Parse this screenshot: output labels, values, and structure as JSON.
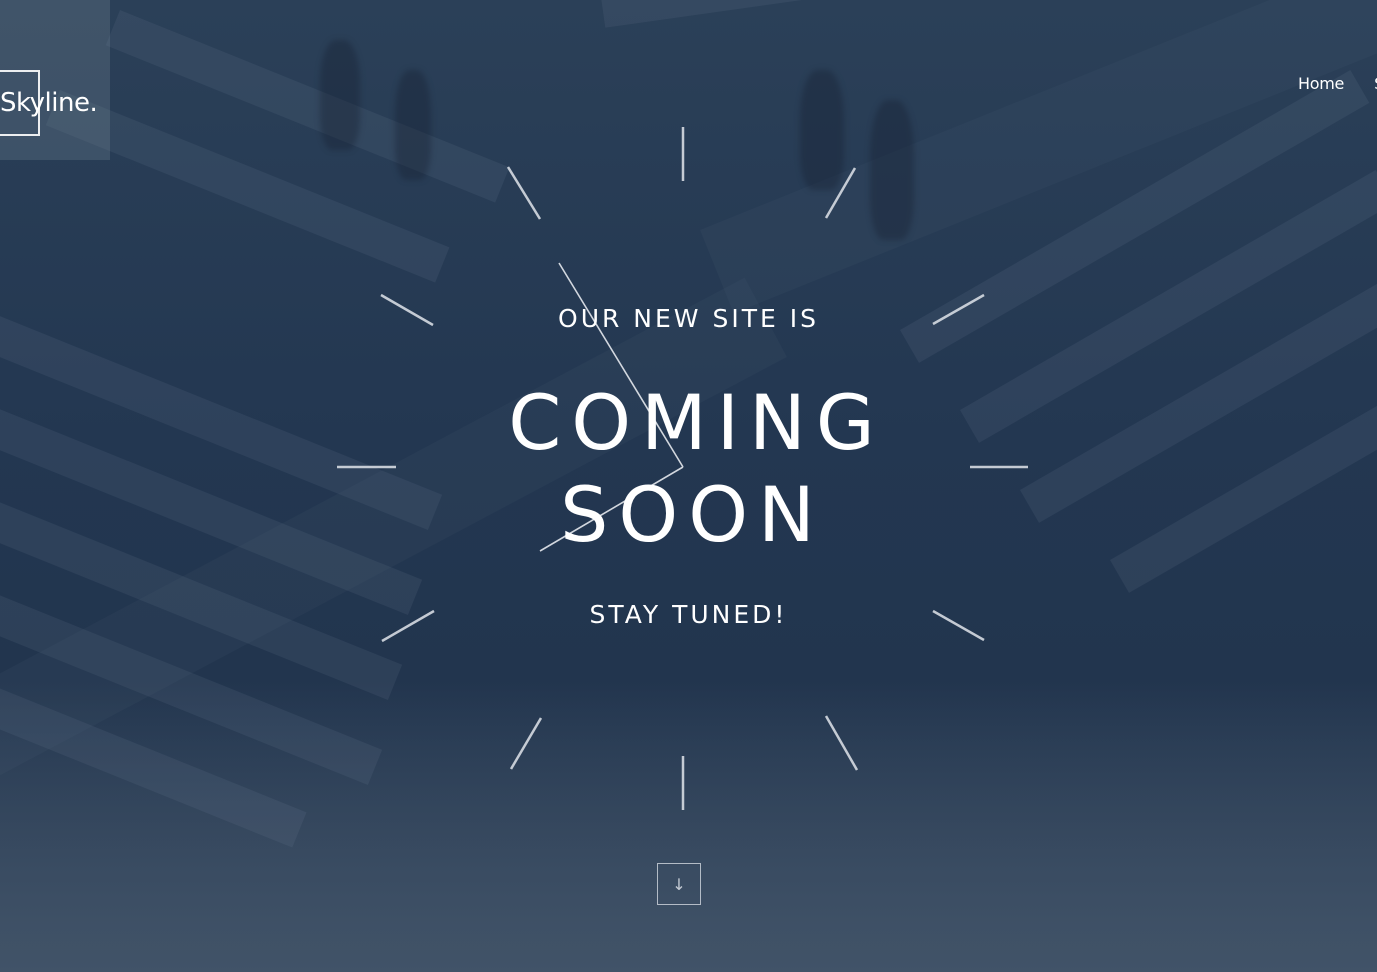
{
  "brand": {
    "logo_text": "Skyline."
  },
  "nav": {
    "items": [
      {
        "label": "Home"
      },
      {
        "label": "S"
      }
    ]
  },
  "hero": {
    "pre_title": "OUR NEW SITE IS",
    "title_line_1": "COMING",
    "title_line_2": "SOON",
    "post_title": "STAY TUNED!",
    "scroll_icon": "arrow-down-icon",
    "scroll_glyph": "↓"
  },
  "colors": {
    "background": "#23364f",
    "text": "#ffffff",
    "rays": "#d6dbe2"
  }
}
